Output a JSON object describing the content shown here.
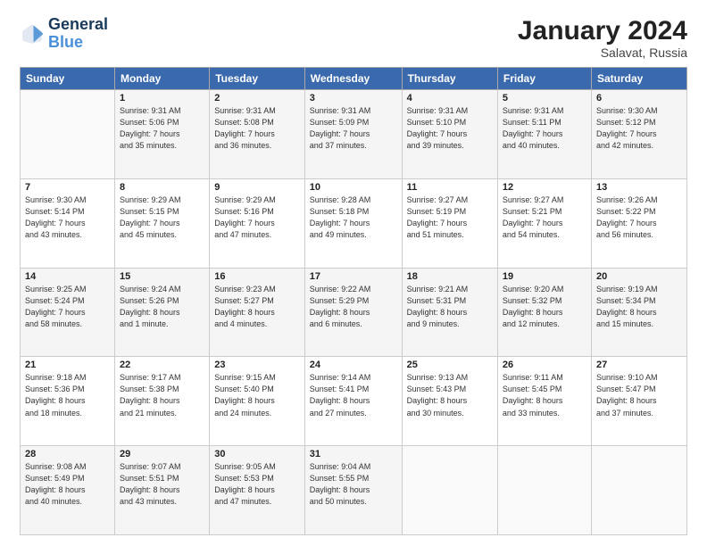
{
  "logo": {
    "line1": "General",
    "line2": "Blue"
  },
  "title": "January 2024",
  "location": "Salavat, Russia",
  "days_header": [
    "Sunday",
    "Monday",
    "Tuesday",
    "Wednesday",
    "Thursday",
    "Friday",
    "Saturday"
  ],
  "weeks": [
    [
      {
        "day": "",
        "info": ""
      },
      {
        "day": "1",
        "info": "Sunrise: 9:31 AM\nSunset: 5:06 PM\nDaylight: 7 hours\nand 35 minutes."
      },
      {
        "day": "2",
        "info": "Sunrise: 9:31 AM\nSunset: 5:08 PM\nDaylight: 7 hours\nand 36 minutes."
      },
      {
        "day": "3",
        "info": "Sunrise: 9:31 AM\nSunset: 5:09 PM\nDaylight: 7 hours\nand 37 minutes."
      },
      {
        "day": "4",
        "info": "Sunrise: 9:31 AM\nSunset: 5:10 PM\nDaylight: 7 hours\nand 39 minutes."
      },
      {
        "day": "5",
        "info": "Sunrise: 9:31 AM\nSunset: 5:11 PM\nDaylight: 7 hours\nand 40 minutes."
      },
      {
        "day": "6",
        "info": "Sunrise: 9:30 AM\nSunset: 5:12 PM\nDaylight: 7 hours\nand 42 minutes."
      }
    ],
    [
      {
        "day": "7",
        "info": "Sunrise: 9:30 AM\nSunset: 5:14 PM\nDaylight: 7 hours\nand 43 minutes."
      },
      {
        "day": "8",
        "info": "Sunrise: 9:29 AM\nSunset: 5:15 PM\nDaylight: 7 hours\nand 45 minutes."
      },
      {
        "day": "9",
        "info": "Sunrise: 9:29 AM\nSunset: 5:16 PM\nDaylight: 7 hours\nand 47 minutes."
      },
      {
        "day": "10",
        "info": "Sunrise: 9:28 AM\nSunset: 5:18 PM\nDaylight: 7 hours\nand 49 minutes."
      },
      {
        "day": "11",
        "info": "Sunrise: 9:27 AM\nSunset: 5:19 PM\nDaylight: 7 hours\nand 51 minutes."
      },
      {
        "day": "12",
        "info": "Sunrise: 9:27 AM\nSunset: 5:21 PM\nDaylight: 7 hours\nand 54 minutes."
      },
      {
        "day": "13",
        "info": "Sunrise: 9:26 AM\nSunset: 5:22 PM\nDaylight: 7 hours\nand 56 minutes."
      }
    ],
    [
      {
        "day": "14",
        "info": "Sunrise: 9:25 AM\nSunset: 5:24 PM\nDaylight: 7 hours\nand 58 minutes."
      },
      {
        "day": "15",
        "info": "Sunrise: 9:24 AM\nSunset: 5:26 PM\nDaylight: 8 hours\nand 1 minute."
      },
      {
        "day": "16",
        "info": "Sunrise: 9:23 AM\nSunset: 5:27 PM\nDaylight: 8 hours\nand 4 minutes."
      },
      {
        "day": "17",
        "info": "Sunrise: 9:22 AM\nSunset: 5:29 PM\nDaylight: 8 hours\nand 6 minutes."
      },
      {
        "day": "18",
        "info": "Sunrise: 9:21 AM\nSunset: 5:31 PM\nDaylight: 8 hours\nand 9 minutes."
      },
      {
        "day": "19",
        "info": "Sunrise: 9:20 AM\nSunset: 5:32 PM\nDaylight: 8 hours\nand 12 minutes."
      },
      {
        "day": "20",
        "info": "Sunrise: 9:19 AM\nSunset: 5:34 PM\nDaylight: 8 hours\nand 15 minutes."
      }
    ],
    [
      {
        "day": "21",
        "info": "Sunrise: 9:18 AM\nSunset: 5:36 PM\nDaylight: 8 hours\nand 18 minutes."
      },
      {
        "day": "22",
        "info": "Sunrise: 9:17 AM\nSunset: 5:38 PM\nDaylight: 8 hours\nand 21 minutes."
      },
      {
        "day": "23",
        "info": "Sunrise: 9:15 AM\nSunset: 5:40 PM\nDaylight: 8 hours\nand 24 minutes."
      },
      {
        "day": "24",
        "info": "Sunrise: 9:14 AM\nSunset: 5:41 PM\nDaylight: 8 hours\nand 27 minutes."
      },
      {
        "day": "25",
        "info": "Sunrise: 9:13 AM\nSunset: 5:43 PM\nDaylight: 8 hours\nand 30 minutes."
      },
      {
        "day": "26",
        "info": "Sunrise: 9:11 AM\nSunset: 5:45 PM\nDaylight: 8 hours\nand 33 minutes."
      },
      {
        "day": "27",
        "info": "Sunrise: 9:10 AM\nSunset: 5:47 PM\nDaylight: 8 hours\nand 37 minutes."
      }
    ],
    [
      {
        "day": "28",
        "info": "Sunrise: 9:08 AM\nSunset: 5:49 PM\nDaylight: 8 hours\nand 40 minutes."
      },
      {
        "day": "29",
        "info": "Sunrise: 9:07 AM\nSunset: 5:51 PM\nDaylight: 8 hours\nand 43 minutes."
      },
      {
        "day": "30",
        "info": "Sunrise: 9:05 AM\nSunset: 5:53 PM\nDaylight: 8 hours\nand 47 minutes."
      },
      {
        "day": "31",
        "info": "Sunrise: 9:04 AM\nSunset: 5:55 PM\nDaylight: 8 hours\nand 50 minutes."
      },
      {
        "day": "",
        "info": ""
      },
      {
        "day": "",
        "info": ""
      },
      {
        "day": "",
        "info": ""
      }
    ]
  ]
}
